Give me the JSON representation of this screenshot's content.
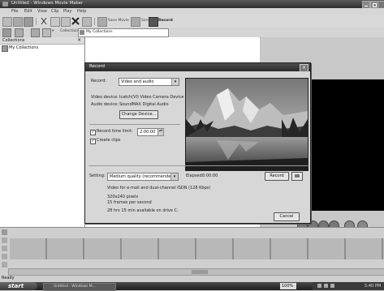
{
  "window": {
    "title": "Untitled - Windows Movie Maker"
  },
  "menu": [
    "File",
    "Edit",
    "View",
    "Clip",
    "Play",
    "Help"
  ],
  "toolbar": {
    "save_movie": "Save Movie",
    "send": "Send",
    "record": "Record"
  },
  "toolbar2": {
    "collection_label": "Collection",
    "collection_value": "My Collections"
  },
  "collections": {
    "header": "Collections",
    "close": "×",
    "item": "My Collections"
  },
  "dialog": {
    "title": "Record",
    "close": "×",
    "record_label": "Record:",
    "record_value": "Video and audio",
    "video_device_label": "Video device:",
    "video_device_value": "Icatch(VI) Video Camera Device",
    "audio_device_label": "Audio device:",
    "audio_device_value": "SoundMAX Digital Audio",
    "change_device": "Change Device...",
    "record_time_limit_label": "Record time limit:",
    "record_time_limit_value": "2:00:00",
    "create_clips_label": "Create clips",
    "setting_label": "Setting:",
    "setting_value": "Medium quality (recommended)",
    "elapsed_label": "Elapsed:",
    "elapsed_value": "0:00:00",
    "record_button": "Record",
    "info_line1": "Video for e-mail and dual-channel ISDN (128 Kbps)",
    "info_line2": "320x240 pixels",
    "info_line3": "15 frames per second",
    "info_line4": "28 hrs 15 min available on drive C:",
    "cancel_button": "Cancel"
  },
  "status": {
    "text": "Ready"
  },
  "taskbar": {
    "start": "start",
    "task": "Untitled - Windows M...",
    "zoom": "100%",
    "clock": "5:40 PM"
  },
  "colors": {
    "dialog_bg": "#d7d7d7",
    "title_bar": "#2e2e2e",
    "preview_bg": "#000000"
  }
}
